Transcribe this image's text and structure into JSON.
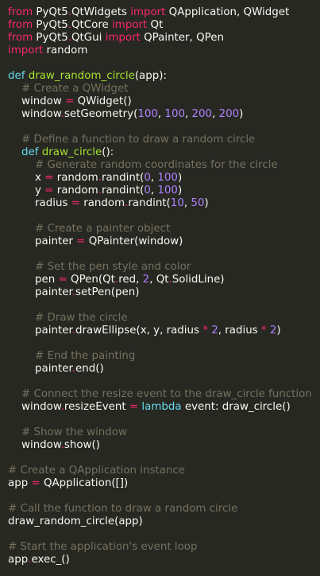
{
  "colors": {
    "background": "#272822",
    "keyword": "#f92672",
    "storage": "#66d9ef",
    "function": "#a6e22e",
    "comment": "#75715e",
    "number": "#ae81ff",
    "text": "#f8f8f2"
  },
  "lines": [
    [
      [
        "kw",
        "from"
      ],
      [
        "id",
        " PyQt5"
      ],
      [
        "dot",
        "."
      ],
      [
        "id",
        "QtWidgets "
      ],
      [
        "kw",
        "import"
      ],
      [
        "id",
        " QApplication, QWidget"
      ]
    ],
    [
      [
        "kw",
        "from"
      ],
      [
        "id",
        " PyQt5"
      ],
      [
        "dot",
        "."
      ],
      [
        "id",
        "QtCore "
      ],
      [
        "kw",
        "import"
      ],
      [
        "id",
        " Qt"
      ]
    ],
    [
      [
        "kw",
        "from"
      ],
      [
        "id",
        " PyQt5"
      ],
      [
        "dot",
        "."
      ],
      [
        "id",
        "QtGui "
      ],
      [
        "kw",
        "import"
      ],
      [
        "id",
        " QPainter, QPen"
      ]
    ],
    [
      [
        "kw",
        "import"
      ],
      [
        "id",
        " random"
      ]
    ],
    [],
    [
      [
        "def",
        "def "
      ],
      [
        "fn",
        "draw_random_circle"
      ],
      [
        "id",
        "(app):"
      ]
    ],
    [
      [
        "cm",
        "    # Create a QWidget"
      ]
    ],
    [
      [
        "id",
        "    window "
      ],
      [
        "op",
        "="
      ],
      [
        "id",
        " QWidget()"
      ]
    ],
    [
      [
        "id",
        "    window"
      ],
      [
        "dot",
        "."
      ],
      [
        "id",
        "setGeometry("
      ],
      [
        "num",
        "100"
      ],
      [
        "id",
        ", "
      ],
      [
        "num",
        "100"
      ],
      [
        "id",
        ", "
      ],
      [
        "num",
        "200"
      ],
      [
        "id",
        ", "
      ],
      [
        "num",
        "200"
      ],
      [
        "id",
        ")"
      ]
    ],
    [],
    [
      [
        "cm",
        "    # Define a function to draw a random circle"
      ]
    ],
    [
      [
        "def",
        "    def "
      ],
      [
        "fn",
        "draw_circle"
      ],
      [
        "id",
        "():"
      ]
    ],
    [
      [
        "cm",
        "        # Generate random coordinates for the circle"
      ]
    ],
    [
      [
        "id",
        "        x "
      ],
      [
        "op",
        "="
      ],
      [
        "id",
        " random"
      ],
      [
        "dot",
        "."
      ],
      [
        "id",
        "randint("
      ],
      [
        "num",
        "0"
      ],
      [
        "id",
        ", "
      ],
      [
        "num",
        "100"
      ],
      [
        "id",
        ")"
      ]
    ],
    [
      [
        "id",
        "        y "
      ],
      [
        "op",
        "="
      ],
      [
        "id",
        " random"
      ],
      [
        "dot",
        "."
      ],
      [
        "id",
        "randint("
      ],
      [
        "num",
        "0"
      ],
      [
        "id",
        ", "
      ],
      [
        "num",
        "100"
      ],
      [
        "id",
        ")"
      ]
    ],
    [
      [
        "id",
        "        radius "
      ],
      [
        "op",
        "="
      ],
      [
        "id",
        " random"
      ],
      [
        "dot",
        "."
      ],
      [
        "id",
        "randint("
      ],
      [
        "num",
        "10"
      ],
      [
        "id",
        ", "
      ],
      [
        "num",
        "50"
      ],
      [
        "id",
        ")"
      ]
    ],
    [],
    [
      [
        "cm",
        "        # Create a painter object"
      ]
    ],
    [
      [
        "id",
        "        painter "
      ],
      [
        "op",
        "="
      ],
      [
        "id",
        " QPainter(window)"
      ]
    ],
    [],
    [
      [
        "cm",
        "        # Set the pen style and color"
      ]
    ],
    [
      [
        "id",
        "        pen "
      ],
      [
        "op",
        "="
      ],
      [
        "id",
        " QPen(Qt"
      ],
      [
        "dot",
        "."
      ],
      [
        "id",
        "red, "
      ],
      [
        "num",
        "2"
      ],
      [
        "id",
        ", Qt"
      ],
      [
        "dot",
        "."
      ],
      [
        "id",
        "SolidLine)"
      ]
    ],
    [
      [
        "id",
        "        painter"
      ],
      [
        "dot",
        "."
      ],
      [
        "id",
        "setPen(pen)"
      ]
    ],
    [],
    [
      [
        "cm",
        "        # Draw the circle"
      ]
    ],
    [
      [
        "id",
        "        painter"
      ],
      [
        "dot",
        "."
      ],
      [
        "id",
        "drawEllipse(x, y, radius "
      ],
      [
        "op",
        "*"
      ],
      [
        "id",
        " "
      ],
      [
        "num",
        "2"
      ],
      [
        "id",
        ", radius "
      ],
      [
        "op",
        "*"
      ],
      [
        "id",
        " "
      ],
      [
        "num",
        "2"
      ],
      [
        "id",
        ")"
      ]
    ],
    [],
    [
      [
        "cm",
        "        # End the painting"
      ]
    ],
    [
      [
        "id",
        "        painter"
      ],
      [
        "dot",
        "."
      ],
      [
        "id",
        "end()"
      ]
    ],
    [],
    [
      [
        "cm",
        "    # Connect the resize event to the draw_circle function"
      ]
    ],
    [
      [
        "id",
        "    window"
      ],
      [
        "dot",
        "."
      ],
      [
        "id",
        "resizeEvent "
      ],
      [
        "op",
        "="
      ],
      [
        "def",
        " lambda"
      ],
      [
        "id",
        " event: draw_circle()"
      ]
    ],
    [],
    [
      [
        "cm",
        "    # Show the window"
      ]
    ],
    [
      [
        "id",
        "    window"
      ],
      [
        "dot",
        "."
      ],
      [
        "id",
        "show()"
      ]
    ],
    [],
    [
      [
        "cm",
        "# Create a QApplication instance"
      ]
    ],
    [
      [
        "id",
        "app "
      ],
      [
        "op",
        "="
      ],
      [
        "id",
        " QApplication([])"
      ]
    ],
    [],
    [
      [
        "cm",
        "# Call the function to draw a random circle"
      ]
    ],
    [
      [
        "id",
        "draw_random_circle(app)"
      ]
    ],
    [],
    [
      [
        "cm",
        "# Start the application's event loop"
      ]
    ],
    [
      [
        "id",
        "app"
      ],
      [
        "dot",
        "."
      ],
      [
        "id",
        "exec_()"
      ]
    ]
  ]
}
